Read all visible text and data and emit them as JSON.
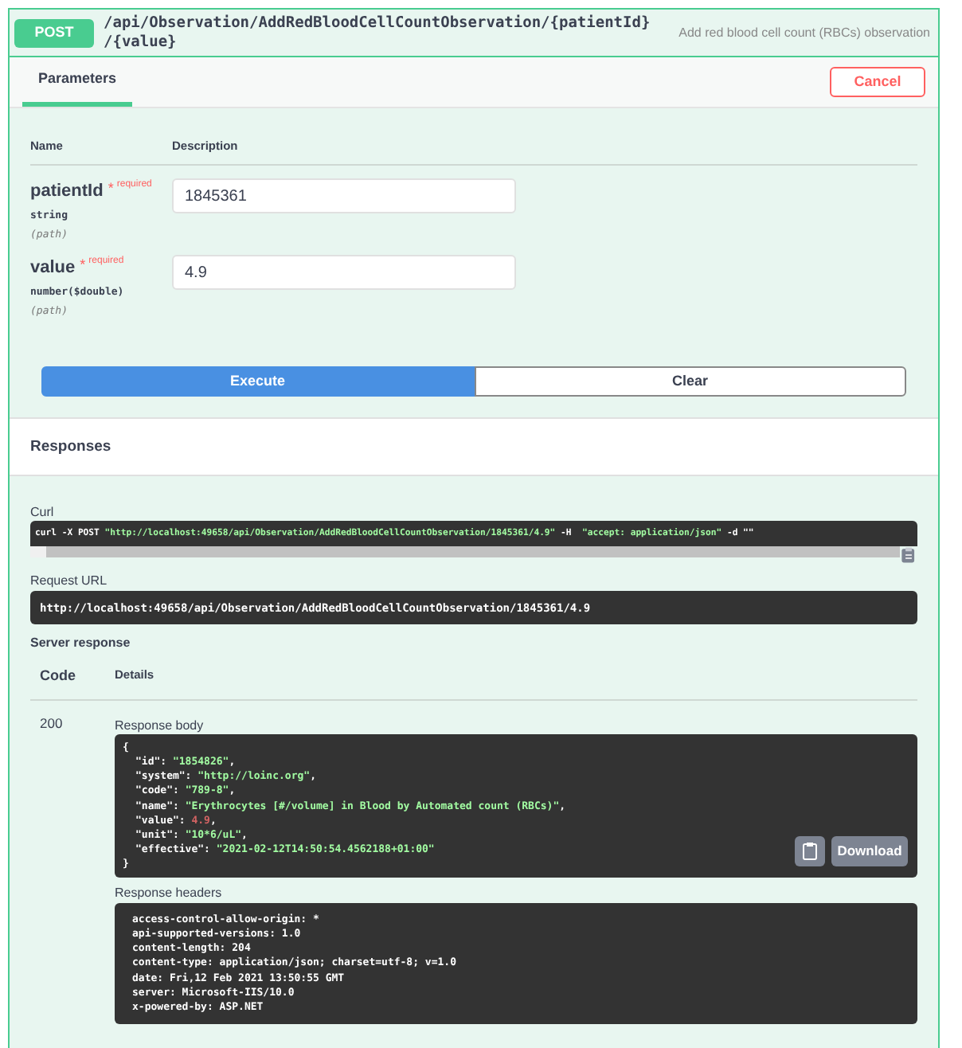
{
  "operation": {
    "method": "POST",
    "path": "/api/Observation/AddRedBloodCellCountObservation/{patientId}\n/{value}",
    "summary": "Add red blood cell count (RBCs) observation"
  },
  "tabs": [
    {
      "label": "Parameters",
      "selected": true
    }
  ],
  "cancel_button": "Cancel",
  "parameter_columns": [
    "Name",
    "Description"
  ],
  "parameters": [
    {
      "name": "patientId",
      "required_mark": "*",
      "required_label": "required",
      "type": "string",
      "location": "(path)",
      "value": "1845361"
    },
    {
      "name": "value",
      "required_mark": "*",
      "required_label": "required",
      "type": "number($double)",
      "location": "(path)",
      "value": "4.9"
    }
  ],
  "execute_button": "Execute",
  "clear_button": "Clear",
  "responses_title": "Responses",
  "curl": {
    "label": "Curl",
    "segments": [
      {
        "kind": "plain",
        "text": "curl -X POST "
      },
      {
        "kind": "string",
        "text": "\"http://localhost:49658/api/Observation/AddRedBloodCellCountObservation/1845361/4.9\""
      },
      {
        "kind": "plain",
        "text": " -H  "
      },
      {
        "kind": "string",
        "text": "\"accept: application/json\""
      },
      {
        "kind": "plain",
        "text": " -d \"\""
      }
    ]
  },
  "request_url": {
    "label": "Request URL",
    "value": "http://localhost:49658/api/Observation/AddRedBloodCellCountObservation/1845361/4.9"
  },
  "server_response": {
    "label": "Server response",
    "columns": [
      "Code",
      "Details"
    ],
    "code": "200",
    "body_label": "Response body",
    "body_open": "{",
    "body_close": "}",
    "body_lines": [
      {
        "key": "\"id\": ",
        "value": "\"1854826\"",
        "kind": "string",
        "tail": ","
      },
      {
        "key": "\"system\": ",
        "value": "\"http://loinc.org\"",
        "kind": "string",
        "tail": ","
      },
      {
        "key": "\"code\": ",
        "value": "\"789-8\"",
        "kind": "string",
        "tail": ","
      },
      {
        "key": "\"name\": ",
        "value": "\"Erythrocytes [#/volume] in Blood by Automated count (RBCs)\"",
        "kind": "string",
        "tail": ","
      },
      {
        "key": "\"value\": ",
        "value": "4.9",
        "kind": "number",
        "tail": ","
      },
      {
        "key": "\"unit\": ",
        "value": "\"10*6/uL\"",
        "kind": "string",
        "tail": ","
      },
      {
        "key": "\"effective\": ",
        "value": "\"2021-02-12T14:50:54.4562188+01:00\"",
        "kind": "string"
      }
    ],
    "download_button": "Download",
    "headers_label": "Response headers",
    "headers": [
      "access-control-allow-origin: *",
      "api-supported-versions: 1.0",
      "content-length: 204",
      "content-type: application/json; charset=utf-8; v=1.0",
      "date: Fri,12 Feb 2021 13:50:55 GMT",
      "server: Microsoft-IIS/10.0",
      "x-powered-by: ASP.NET"
    ]
  }
}
